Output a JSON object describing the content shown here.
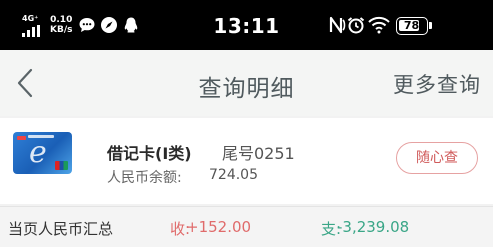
{
  "status_bar": {
    "network": "4G⁺",
    "speed_value": "0.10",
    "speed_unit": "KB/s",
    "time": "13:11",
    "battery": "78",
    "icons": [
      "signal-icon",
      "chat-bubble-icon",
      "compass-icon",
      "penguin-icon",
      "nfc-icon",
      "alarm-icon",
      "wifi-icon",
      "battery-icon"
    ]
  },
  "nav": {
    "back_icon": "chevron-left-icon",
    "title": "查询明细",
    "more": "更多查询"
  },
  "card": {
    "name": "借记卡(Ⅰ类)",
    "tail": "尾号0251",
    "balance_label": "人民币余额:",
    "balance": "724.05",
    "query_button": "随心查"
  },
  "summary": {
    "label": "当页人民币汇总",
    "income_label": "收:",
    "income_value": "+152.00",
    "expense_label": "支:",
    "expense_value": "-3,239.08"
  },
  "colors": {
    "income": "#e06b6b",
    "expense": "#3aa687",
    "nav_text": "#505a5e",
    "button_border": "#e6a2a2"
  }
}
